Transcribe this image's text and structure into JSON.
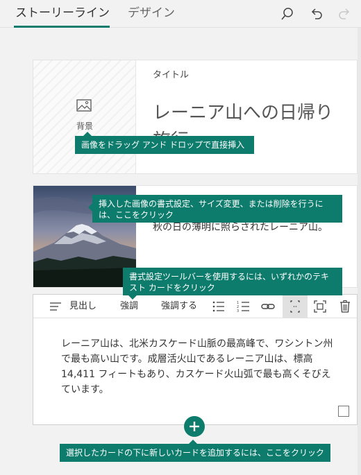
{
  "tabs": {
    "storyline": "ストーリーライン",
    "design": "デザイン"
  },
  "top_icons": [
    "search-icon",
    "undo-icon",
    "redo-icon"
  ],
  "title_card": {
    "background_label": "背景",
    "title_label": "タイトル",
    "title_text": "レーニア山への日帰り旅行"
  },
  "image_card": {
    "caption": "秋の日の薄明に照らされたレーニア山。"
  },
  "text_card": {
    "toolbar": {
      "heading": "見出し",
      "emphasis": "強調",
      "strong": "強調する"
    },
    "body": "レーニア山は、北米カスケード山脈の最高峰で、ワシントン州で最も高い山です。成層活火山であるレーニア山は、標高 14,411 フィートもあり、カスケード火山弧で最も高くそびえています。"
  },
  "tooltips": {
    "insert_image": "画像をドラッグ アンド ドロップで直接挿入",
    "format_image": "挿入した画像の書式設定、サイズ変更、または削除を行うには、ここをクリック",
    "format_toolbar": "書式設定ツールバーを使用するには、いずれかのテキスト カードをクリック",
    "add_card": "選択したカードの下に新しいカードを追加するには、ここをクリック"
  },
  "colors": {
    "accent": "#0e7c6c"
  }
}
